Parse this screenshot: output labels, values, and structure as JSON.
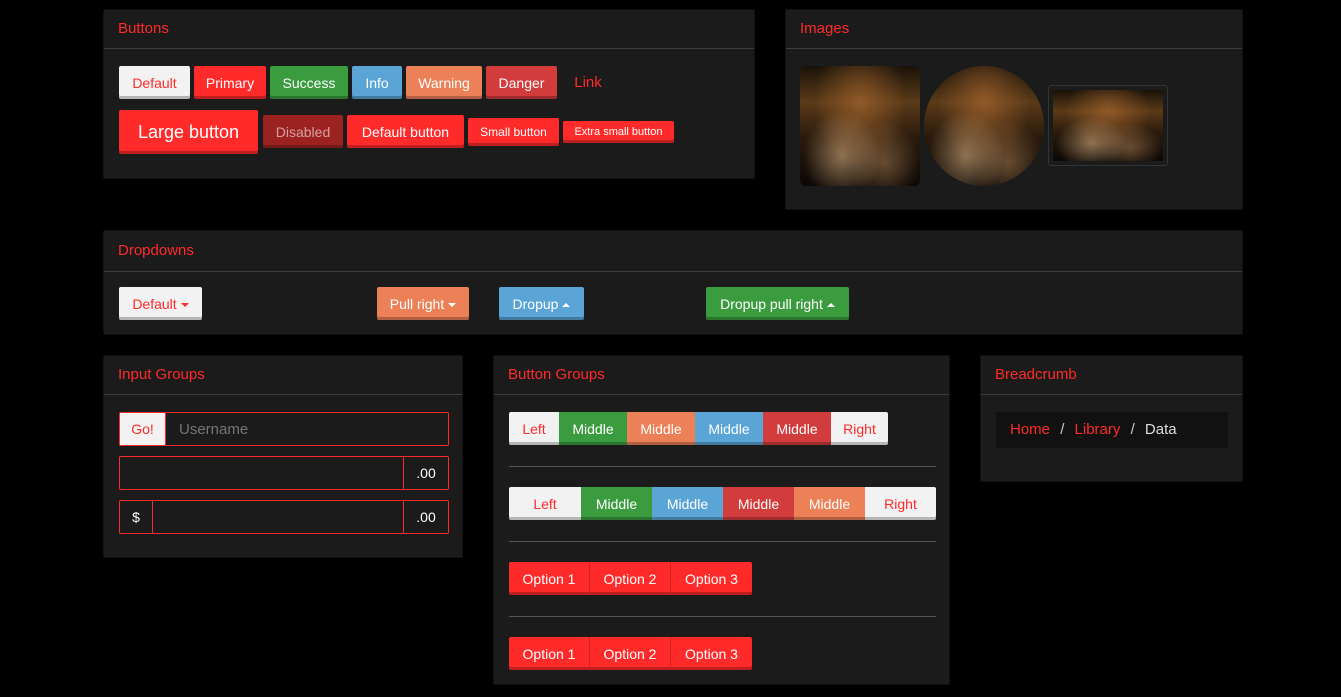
{
  "buttons_panel": {
    "title": "Buttons",
    "row1": [
      "Default",
      "Primary",
      "Success",
      "Info",
      "Warning",
      "Danger",
      "Link"
    ],
    "row2": [
      "Large button",
      "Disabled",
      "Default button",
      "Small button",
      "Extra small button"
    ]
  },
  "images_panel": {
    "title": "Images"
  },
  "dropdowns_panel": {
    "title": "Dropdowns",
    "items": [
      "Default",
      "Pull right",
      "Dropup",
      "Dropup pull right"
    ]
  },
  "input_groups_panel": {
    "title": "Input Groups",
    "go_label": "Go!",
    "username_placeholder": "Username",
    "suffix_1": ".00",
    "prefix_2": "$",
    "suffix_2": ".00"
  },
  "button_groups_panel": {
    "title": "Button Groups",
    "group1": [
      "Left",
      "Middle",
      "Middle",
      "Middle",
      "Middle",
      "Right"
    ],
    "group2": [
      "Left",
      "Middle",
      "Middle",
      "Middle",
      "Middle",
      "Right"
    ],
    "group3": [
      "Option 1",
      "Option 2",
      "Option 3"
    ],
    "group4": [
      "Option 1",
      "Option 2",
      "Option 3"
    ]
  },
  "breadcrumb_panel": {
    "title": "Breadcrumb",
    "items": [
      "Home",
      "Library",
      "Data"
    ],
    "separator": "/"
  },
  "colors": {
    "accent": "#ff2a2a",
    "success": "#3a9c3f",
    "info": "#5aa5d6",
    "warning": "#ec8158",
    "danger": "#d23c3c",
    "panel": "#1b1b1b",
    "background": "#000000"
  }
}
